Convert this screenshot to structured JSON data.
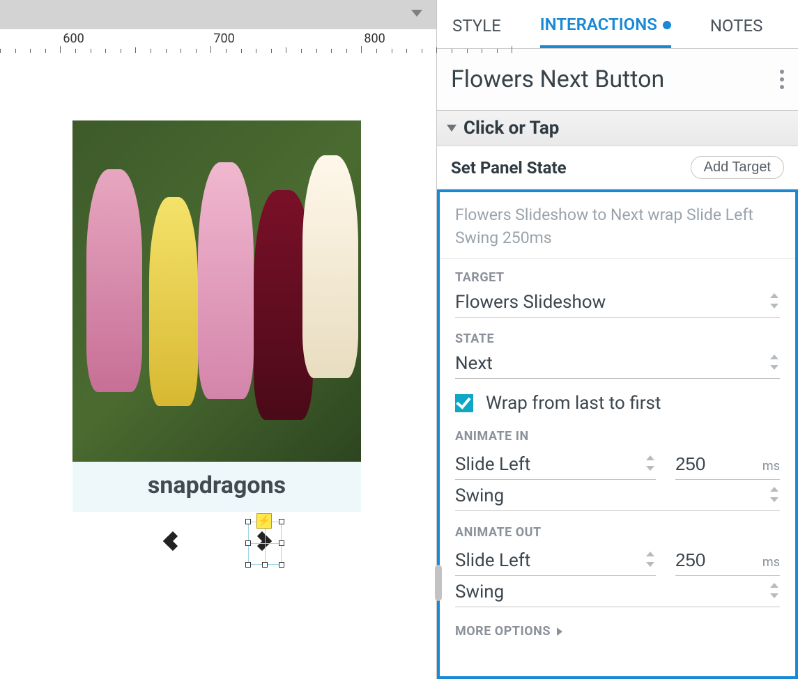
{
  "ruler": {
    "marks": [
      600,
      700,
      800
    ]
  },
  "slideshow": {
    "caption": "snapdragons"
  },
  "panel": {
    "tabs": {
      "style": "STYLE",
      "interactions": "INTERACTIONS",
      "notes": "NOTES"
    },
    "element_name": "Flowers Next Button",
    "event": "Click or Tap",
    "action_label": "Set Panel State",
    "add_target_label": "Add Target",
    "summary": "Flowers Slideshow to Next wrap Slide Left Swing 250ms",
    "target_label": "TARGET",
    "target_value": "Flowers Slideshow",
    "state_label": "STATE",
    "state_value": "Next",
    "wrap_label": "Wrap from last to first",
    "wrap_checked": true,
    "animate_in_label": "ANIMATE IN",
    "animate_in_type": "Slide Left",
    "animate_in_duration": "250",
    "animate_in_easing": "Swing",
    "animate_out_label": "ANIMATE OUT",
    "animate_out_type": "Slide Left",
    "animate_out_duration": "250",
    "animate_out_easing": "Swing",
    "ms_label": "ms",
    "more_options_label": "MORE OPTIONS"
  }
}
